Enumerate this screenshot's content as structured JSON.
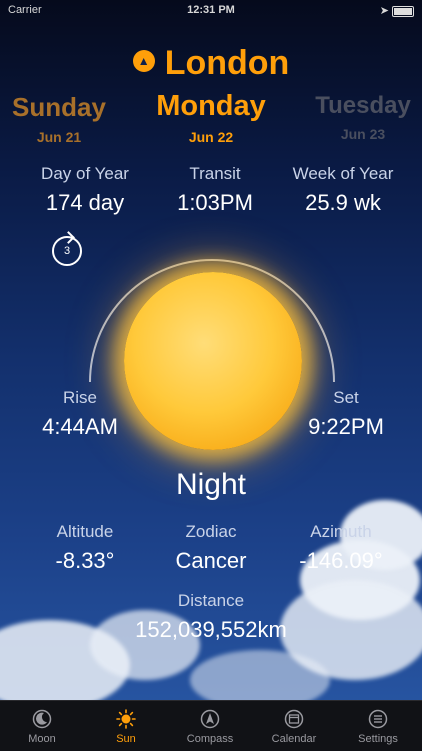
{
  "status_bar": {
    "carrier": "Carrier",
    "time": "12:31 PM"
  },
  "header": {
    "city": "London",
    "location_icon": "location-arrow-icon",
    "accent_color": "#ff9f0a"
  },
  "days": {
    "previous": {
      "name": "Sunday",
      "date": "Jun 21"
    },
    "current": {
      "name": "Monday",
      "date": "Jun 22"
    },
    "next": {
      "name": "Tuesday",
      "date": "Jun 23"
    }
  },
  "stats": {
    "day_of_year": {
      "label": "Day of Year",
      "value": "174 day"
    },
    "transit": {
      "label": "Transit",
      "value": "1:03PM"
    },
    "week_of_year": {
      "label": "Week of Year",
      "value": "25.9 wk"
    },
    "rise": {
      "label": "Rise",
      "value": "4:44AM"
    },
    "set": {
      "label": "Set",
      "value": "9:22PM"
    },
    "altitude": {
      "label": "Altitude",
      "value": "-8.33°"
    },
    "zodiac": {
      "label": "Zodiac",
      "value": "Cancer"
    },
    "azimuth": {
      "label": "Azimuth",
      "value": "-146.09°"
    },
    "distance": {
      "label": "Distance",
      "value": "152,039,552km"
    }
  },
  "reset_button": {
    "label": "3"
  },
  "phase": "Night",
  "tabs": [
    {
      "label": "Moon",
      "icon": "moon-icon"
    },
    {
      "label": "Sun",
      "icon": "sun-icon"
    },
    {
      "label": "Compass",
      "icon": "compass-icon"
    },
    {
      "label": "Calendar",
      "icon": "calendar-icon"
    },
    {
      "label": "Settings",
      "icon": "settings-icon"
    }
  ]
}
